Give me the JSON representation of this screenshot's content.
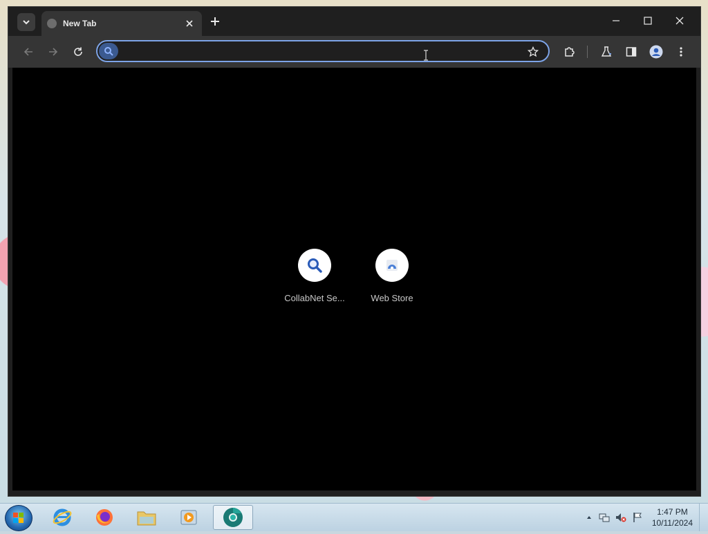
{
  "browser": {
    "tab": {
      "title": "New Tab"
    },
    "omnibox": {
      "value": "",
      "placeholder": ""
    },
    "colors": {
      "accent": "#7da4e8",
      "background": "#000000",
      "toolbar": "#353535",
      "tabstrip": "#1f1f1f"
    },
    "icons": {
      "tab_search": "chevron-down-icon",
      "tab_close": "close-icon",
      "new_tab": "plus-icon",
      "minimize": "minimize-icon",
      "maximize": "maximize-icon",
      "close": "close-icon",
      "back": "back-arrow-icon",
      "forward": "forward-arrow-icon",
      "reload": "reload-icon",
      "bookmark": "star-icon",
      "extensions": "puzzle-icon",
      "labs": "flask-icon",
      "side_panel": "side-panel-icon",
      "profile": "profile-icon",
      "menu": "kebab-menu-icon"
    }
  },
  "new_tab_page": {
    "shortcuts": [
      {
        "label": "CollabNet Se...",
        "icon": "search-icon"
      },
      {
        "label": "Web Store",
        "icon": "web-store-icon"
      }
    ]
  },
  "taskbar": {
    "apps": [
      {
        "name": "Internet Explorer",
        "icon": "internet-explorer-icon"
      },
      {
        "name": "Firefox",
        "icon": "firefox-icon"
      },
      {
        "name": "Windows Explorer",
        "icon": "folder-icon"
      },
      {
        "name": "Media Player",
        "icon": "media-player-icon"
      },
      {
        "name": "Chrome Beta",
        "icon": "chrome-icon"
      }
    ],
    "clock": {
      "time": "1:47 PM",
      "date": "10/11/2024"
    }
  }
}
